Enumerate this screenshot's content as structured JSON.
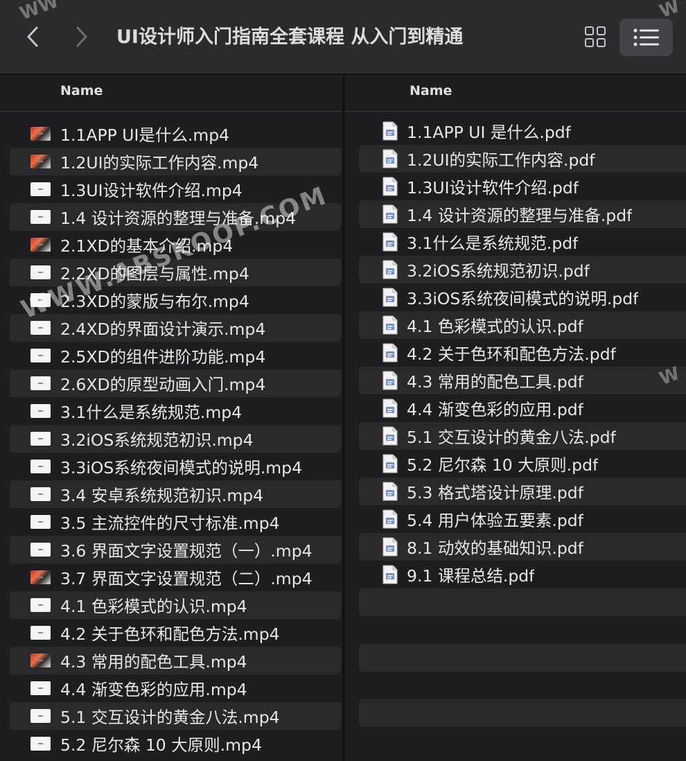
{
  "window": {
    "title": "UI设计师入门指南全套课程  从入门到精通"
  },
  "toolbar": {
    "back_icon": "chevron-left-icon",
    "forward_icon": "chevron-right-icon",
    "grid_view_icon": "grid-view-icon",
    "list_view_icon": "list-view-icon"
  },
  "left_pane": {
    "column_header": "Name",
    "files": [
      {
        "name": "1.1APP UI是什么.mp4",
        "icon": "video-thumbnail-icon"
      },
      {
        "name": "1.2UI的实际工作内容.mp4",
        "icon": "video-thumbnail-icon"
      },
      {
        "name": "1.3UI设计软件介绍.mp4",
        "icon": "video-file-icon"
      },
      {
        "name": "1.4 设计资源的整理与准备.mp4",
        "icon": "video-file-icon"
      },
      {
        "name": "2.1XD的基本介绍.mp4",
        "icon": "video-thumbnail-icon"
      },
      {
        "name": "2.2XD的图层与属性.mp4",
        "icon": "video-file-icon"
      },
      {
        "name": "2.3XD的蒙版与布尔.mp4",
        "icon": "video-file-icon"
      },
      {
        "name": "2.4XD的界面设计演示.mp4",
        "icon": "video-file-icon"
      },
      {
        "name": "2.5XD的组件进阶功能.mp4",
        "icon": "video-file-icon"
      },
      {
        "name": "2.6XD的原型动画入门.mp4",
        "icon": "video-file-icon"
      },
      {
        "name": "3.1什么是系统规范.mp4",
        "icon": "video-file-icon"
      },
      {
        "name": "3.2iOS系统规范初识.mp4",
        "icon": "video-file-icon"
      },
      {
        "name": "3.3iOS系统夜间模式的说明.mp4",
        "icon": "video-file-icon"
      },
      {
        "name": "3.4 安卓系统规范初识.mp4",
        "icon": "video-file-icon"
      },
      {
        "name": "3.5 主流控件的尺寸标准.mp4",
        "icon": "video-file-icon"
      },
      {
        "name": "3.6 界面文字设置规范（一）.mp4",
        "icon": "video-file-icon"
      },
      {
        "name": "3.7 界面文字设置规范（二）.mp4",
        "icon": "video-thumbnail-icon"
      },
      {
        "name": "4.1 色彩模式的认识.mp4",
        "icon": "video-file-icon"
      },
      {
        "name": "4.2 关于色环和配色方法.mp4",
        "icon": "video-file-icon"
      },
      {
        "name": "4.3 常用的配色工具.mp4",
        "icon": "video-thumbnail-icon"
      },
      {
        "name": "4.4 渐变色彩的应用.mp4",
        "icon": "video-file-icon"
      },
      {
        "name": "5.1 交互设计的黄金八法.mp4",
        "icon": "video-file-icon"
      },
      {
        "name": "5.2 尼尔森 10 大原则.mp4",
        "icon": "video-file-icon"
      }
    ]
  },
  "right_pane": {
    "column_header": "Name",
    "files": [
      {
        "name": "1.1APP UI 是什么.pdf",
        "icon": "pdf-file-icon"
      },
      {
        "name": "1.2UI的实际工作内容.pdf",
        "icon": "pdf-file-icon"
      },
      {
        "name": "1.3UI设计软件介绍.pdf",
        "icon": "pdf-file-icon"
      },
      {
        "name": "1.4 设计资源的整理与准备.pdf",
        "icon": "pdf-file-icon"
      },
      {
        "name": "3.1什么是系统规范.pdf",
        "icon": "pdf-file-icon"
      },
      {
        "name": "3.2iOS系统规范初识.pdf",
        "icon": "pdf-file-icon"
      },
      {
        "name": "3.3iOS系统夜间模式的说明.pdf",
        "icon": "pdf-file-icon"
      },
      {
        "name": "4.1 色彩模式的认识.pdf",
        "icon": "pdf-file-icon"
      },
      {
        "name": "4.2 关于色环和配色方法.pdf",
        "icon": "pdf-file-icon"
      },
      {
        "name": "4.3 常用的配色工具.pdf",
        "icon": "pdf-file-icon"
      },
      {
        "name": "4.4 渐变色彩的应用.pdf",
        "icon": "pdf-file-icon"
      },
      {
        "name": "5.1 交互设计的黄金八法.pdf",
        "icon": "pdf-file-icon"
      },
      {
        "name": "5.2 尼尔森 10 大原则.pdf",
        "icon": "pdf-file-icon"
      },
      {
        "name": "5.3 格式塔设计原理.pdf",
        "icon": "pdf-file-icon"
      },
      {
        "name": "5.4 用户体验五要素.pdf",
        "icon": "pdf-file-icon"
      },
      {
        "name": "8.1 动效的基础知识.pdf",
        "icon": "pdf-file-icon"
      },
      {
        "name": "9.1 课程总结.pdf",
        "icon": "pdf-file-icon"
      }
    ],
    "empty_rows": 6
  },
  "watermark": {
    "text": "WWW.ABSKOOP.COM",
    "corner_left": "WW",
    "corner_right": "W",
    "edge_right": "W"
  },
  "colors": {
    "background": "#1e1e21",
    "toolbar": "#2b2b2e",
    "row_alt": "#2a2a2d",
    "text": "#e8e8ea"
  }
}
